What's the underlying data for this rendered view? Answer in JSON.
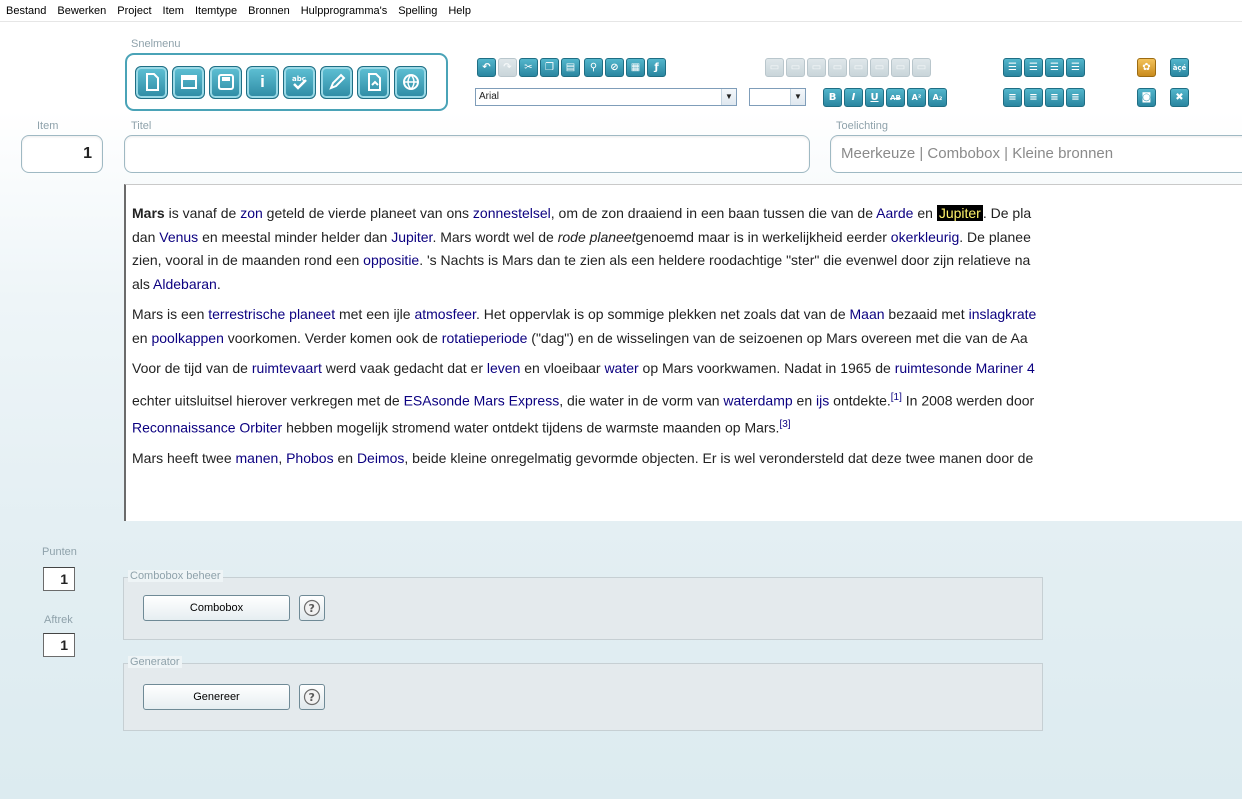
{
  "menu": [
    "Bestand",
    "Bewerken",
    "Project",
    "Item",
    "Itemtype",
    "Bronnen",
    "Hulpprogramma's",
    "Spelling",
    "Help"
  ],
  "snelmenu": {
    "label": "Snelmenu",
    "buttons": [
      "new-document",
      "open-document",
      "save",
      "info",
      "spellcheck",
      "edit",
      "export-pdf",
      "web"
    ]
  },
  "toolbar": {
    "font": "Arial",
    "size": "",
    "format_buttons": [
      "B",
      "I",
      "U",
      "AB",
      "A²",
      "A₂"
    ]
  },
  "labels": {
    "item": "Item",
    "titel": "Titel",
    "toelichting": "Toelichting",
    "punten": "Punten",
    "aftrek": "Aftrek"
  },
  "fields": {
    "item_number": "1",
    "titel": "",
    "toelichting": "Meerkeuze | Combobox | Kleine bronnen",
    "punten": "1",
    "aftrek": "1"
  },
  "article": {
    "p1": {
      "s1": "Mars",
      "s2": " is vanaf de ",
      "l_zon": "zon",
      "s3": " geteld de vierde planeet van ons ",
      "l_zonnestelsel": "zonnestelsel",
      "s4": ", om de zon draaiend in een baan tussen die van de ",
      "l_aarde": "Aarde",
      "s5": " en ",
      "hl": "Jupiter",
      "s6": ". De pla",
      "s7": "dan ",
      "l_venus": "Venus",
      "s8": " en meestal minder helder dan ",
      "l_jupiter": "Jupiter",
      "s9": ". Mars wordt wel de ",
      "em": "rode planeet",
      "s10": "genoemd maar is in werkelijkheid eerder ",
      "l_okerkleurig": "okerkleurig",
      "s11": ". De planee",
      "s12": "zien, vooral in de maanden rond een ",
      "l_oppositie": "oppositie",
      "s13": ". 's Nachts is Mars dan te zien als een heldere roodachtige \"ster\" die evenwel door zijn relatieve na",
      "s14": "als ",
      "l_aldebaran": "Aldebaran",
      "s15": "."
    },
    "p2": {
      "s1": "Mars is een ",
      "l_terrestrische": "terrestrische planeet",
      "s2": " met een ijle ",
      "l_atmosfeer": "atmosfeer",
      "s3": ". Het oppervlak is op sommige plekken net zoals dat van de ",
      "l_maan": "Maan",
      "s4": " bezaaid met ",
      "l_inslagkrate": "inslagkrate",
      "s5": "en ",
      "l_poolkappen": "poolkappen",
      "s6": " voorkomen. Verder komen ook de ",
      "l_rotatieperiode": "rotatieperiode",
      "s7": " (\"dag\") en de wisselingen van de seizoenen op Mars overeen met die van de Aa"
    },
    "p3": {
      "s1": "Voor de tijd van de ",
      "l_ruimtevaart": "ruimtevaart",
      "s2": " werd vaak gedacht dat er ",
      "l_leven": "leven",
      "s3": " en vloeibaar ",
      "l_water": "water",
      "s4": " op Mars voorkwamen. Nadat in 1965 de ",
      "l_ruimtesonde": "ruimtesonde",
      "s5": " ",
      "l_mariner": "Mariner 4",
      "s6": "echter uitsluitsel hierover verkregen met de ",
      "l_esasonde": "ESAsonde",
      "s7": " ",
      "l_marsexpress": "Mars Express",
      "s8": ", die water in de vorm van ",
      "l_waterdamp": "waterdamp",
      "s9": " en ",
      "l_ijs": "ijs",
      "s10": " ontdekte.",
      "sup1": "[1]",
      "s11": " In 2008 werden door",
      "l_reconnaissance": "Reconnaissance Orbiter",
      "s12": " hebben mogelijk stromend water ontdekt tijdens de warmste maanden op Mars.",
      "sup3": "[3]"
    },
    "p4": {
      "s1": "Mars heeft twee ",
      "l_manen": "manen",
      "s2": ", ",
      "l_phobos": "Phobos",
      "s3": " en ",
      "l_deimos": "Deimos",
      "s4": ", beide kleine onregelmatig gevormde objecten. Er is wel verondersteld dat deze twee manen door de"
    }
  },
  "combobox_beheer": {
    "legend": "Combobox beheer",
    "button": "Combobox"
  },
  "generator": {
    "legend": "Generator",
    "button": "Genereer"
  },
  "colors": {
    "accent": "#2e8aa3",
    "link": "#0b0080",
    "highlight_bg": "#000000",
    "highlight_fg": "#fff36a"
  }
}
